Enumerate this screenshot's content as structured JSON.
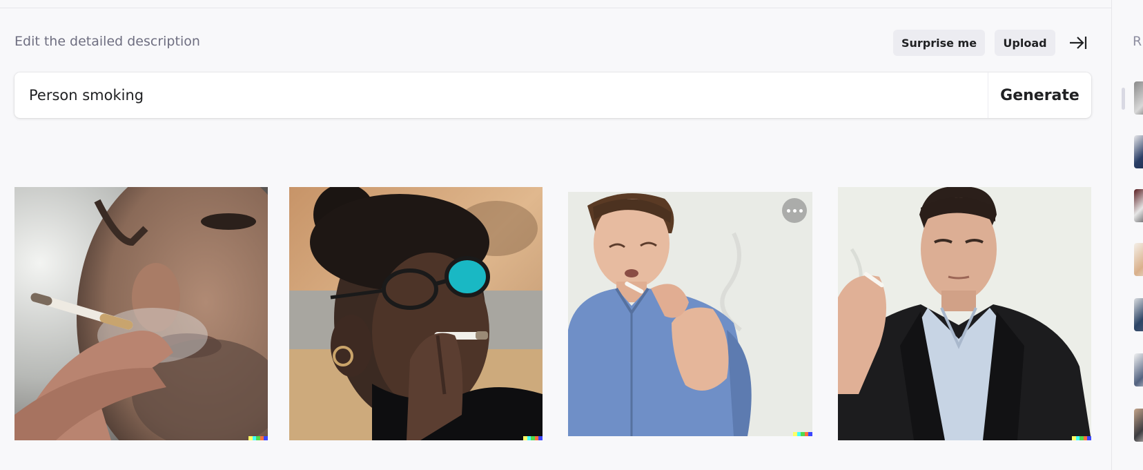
{
  "header": {
    "label": "Edit the detailed description",
    "surprise_label": "Surprise me",
    "upload_label": "Upload"
  },
  "prompt": {
    "value": "Person smoking",
    "generate_label": "Generate"
  },
  "images": [
    {
      "description": "Close-up of man exhaling smoke, cigarette in hand"
    },
    {
      "description": "Woman with glasses holding cigarette to lips"
    },
    {
      "description": "Young man in blue shirt smoking"
    },
    {
      "description": "Man in black suit holding cigarette"
    }
  ],
  "history_panel": {
    "letter": "R"
  },
  "colors": {
    "background": "#f8f8fa",
    "button_bg": "#ececf1",
    "signature": [
      "#ffff66",
      "#42ffff",
      "#51da4c",
      "#ff6e3c",
      "#3c46ff"
    ]
  }
}
